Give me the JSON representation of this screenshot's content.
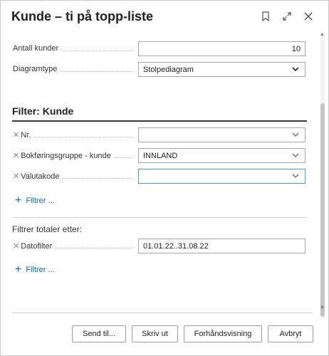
{
  "dialog": {
    "title": "Kunde – ti på topp-liste",
    "icons": [
      "bookmark-icon",
      "expand-icon",
      "close-icon"
    ]
  },
  "options": {
    "antall_kunder_label": "Antall kunder",
    "antall_kunder_value": "10",
    "diagramtype_label": "Diagramtype",
    "diagramtype_value": "Stolpediagram"
  },
  "filter_kunde": {
    "title": "Filter: Kunde",
    "fields": [
      {
        "label": "Nr.",
        "value": ""
      },
      {
        "label": "Bokføringsgruppe - kunde",
        "value": "INNLAND"
      },
      {
        "label": "Valutakode",
        "value": ""
      }
    ],
    "add_filter_label": "Filtrer ..."
  },
  "totals": {
    "title": "Filtrer totaler etter:",
    "datofilter_label": "Datofilter",
    "datofilter_value": "01.01.22..31.08.22",
    "add_filter_label": "Filtrer ..."
  },
  "buttons": {
    "send": "Send til...",
    "print": "Skriv ut",
    "preview": "Forhåndsvisning",
    "cancel": "Avbryt"
  },
  "colors": {
    "accent": "#0b6fb6",
    "focus_border": "#4b9ad8"
  }
}
